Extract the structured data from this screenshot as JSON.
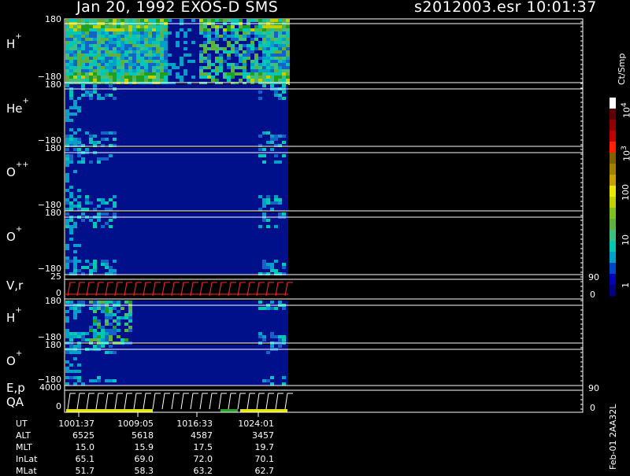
{
  "header": {
    "date_title": "Jan 20, 1992   EXOS-D SMS",
    "source": "s2012003.esr  10:01:37"
  },
  "chart_data": {
    "type": "heatmap",
    "title": "Jan 20, 1992   EXOS-D SMS",
    "panels": [
      {
        "id": "h1",
        "label_main": "H",
        "label_sup": "+",
        "y_ticks": [
          "180",
          "−180"
        ],
        "ylim": [
          -180,
          180
        ]
      },
      {
        "id": "he",
        "label_main": "He",
        "label_sup": "+",
        "y_ticks": [
          "180",
          "−180"
        ],
        "ylim": [
          -180,
          180
        ]
      },
      {
        "id": "opp",
        "label_main": "O",
        "label_sup": "++",
        "y_ticks": [
          "180",
          "−180"
        ],
        "ylim": [
          -180,
          180
        ]
      },
      {
        "id": "op",
        "label_main": "O",
        "label_sup": "+",
        "y_ticks": [
          "180",
          "−180"
        ],
        "ylim": [
          -180,
          180
        ]
      },
      {
        "id": "vr",
        "label_main": "V,r",
        "label_sup": "",
        "y_ticks": [
          "25",
          "0"
        ],
        "right_ticks": [
          "90",
          "0"
        ],
        "ylim": [
          0,
          25
        ]
      },
      {
        "id": "h2",
        "label_main": "H",
        "label_sup": "+",
        "y_ticks": [
          "180",
          "−180"
        ],
        "ylim": [
          -180,
          180
        ]
      },
      {
        "id": "o2",
        "label_main": "O",
        "label_sup": "+",
        "y_ticks": [
          "180",
          "−180"
        ],
        "ylim": [
          -180,
          180
        ]
      },
      {
        "id": "ep",
        "label_main": "E,p",
        "label_sup": "",
        "label_second": "QA",
        "y_ticks": [
          "4000",
          "0"
        ],
        "right_ticks": [
          "90",
          "0"
        ],
        "ylim": [
          0,
          4000
        ]
      }
    ],
    "colorbar": {
      "unit": "Ct/Smp",
      "tick_labels": [
        {
          "base": "10",
          "exp": "4"
        },
        {
          "base": "10",
          "exp": "3"
        },
        {
          "base": "100",
          "exp": ""
        },
        {
          "base": "10",
          "exp": ""
        },
        {
          "base": "1",
          "exp": ""
        }
      ],
      "colors": [
        "#000080",
        "#0000b4",
        "#0046c8",
        "#00a0c8",
        "#00c8b4",
        "#40c080",
        "#60b040",
        "#80c020",
        "#c0d000",
        "#e8e800",
        "#c8a000",
        "#a08000",
        "#806000",
        "#ff2000",
        "#c00000",
        "#900000",
        "#600000",
        "#ffffff"
      ]
    },
    "x_axis": {
      "rows": [
        {
          "name": "UT",
          "values": [
            "1001:37",
            "1009:05",
            "1016:33",
            "1024:01"
          ]
        },
        {
          "name": "ALT",
          "values": [
            "6525",
            "5618",
            "4587",
            "3457"
          ]
        },
        {
          "name": "MLT",
          "values": [
            "15.0",
            "15.9",
            "17.5",
            "19.7"
          ]
        },
        {
          "name": "InLat",
          "values": [
            "65.1",
            "69.0",
            "72.0",
            "70.1"
          ]
        },
        {
          "name": "MLat",
          "values": [
            "51.7",
            "58.3",
            "63.2",
            "62.7"
          ]
        }
      ]
    }
  },
  "side_code": "Feb-01 2AA32L"
}
